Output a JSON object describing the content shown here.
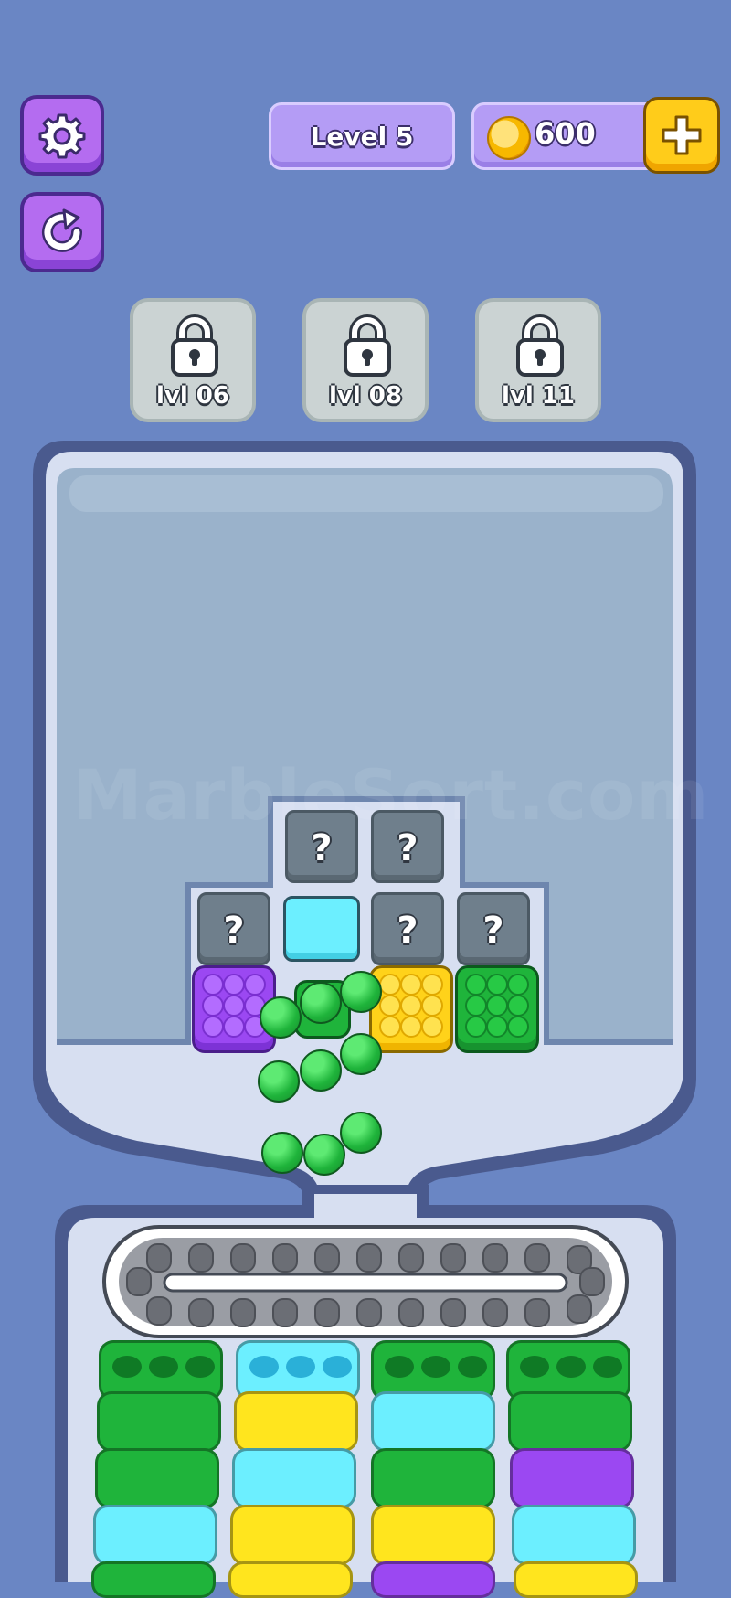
{
  "hud": {
    "settings_icon": "gear-icon",
    "restart_icon": "restart-icon",
    "level_label": "Level 5",
    "coins": "600",
    "coin_icon": "coin-icon",
    "add_icon": "plus-icon"
  },
  "locked_slots": [
    {
      "label": "lvl 06",
      "icon": "lock-icon"
    },
    {
      "label": "lvl 08",
      "icon": "lock-icon"
    },
    {
      "label": "lvl 11",
      "icon": "lock-icon"
    }
  ],
  "watermark": "MarbleSort.com",
  "grid": {
    "hidden_tile_label": "?",
    "tiles": [
      "?",
      "?",
      "?",
      "?",
      "?",
      "?"
    ],
    "boxes": [
      {
        "color": "purple",
        "hex": "#9b48f2"
      },
      {
        "color": "green",
        "hex": "#1fb43b"
      },
      {
        "color": "yellow",
        "hex": "#ffd21a"
      },
      {
        "color": "green",
        "hex": "#1fb43b"
      }
    ]
  },
  "colors": {
    "background": "#6a86c4",
    "container": "#95aecb",
    "green": "#1fb43b",
    "cyan": "#6cefff",
    "yellow": "#ffe51e",
    "purple": "#9b48f2"
  },
  "tubes": [
    {
      "cap": "green",
      "stack": [
        "green",
        "green",
        "cyan",
        "green"
      ]
    },
    {
      "cap": "cyan",
      "stack": [
        "yellow",
        "cyan",
        "yellow",
        "yellow"
      ]
    },
    {
      "cap": "green",
      "stack": [
        "cyan",
        "green",
        "yellow",
        "purple"
      ]
    },
    {
      "cap": "green",
      "stack": [
        "green",
        "purple",
        "cyan",
        "yellow"
      ]
    }
  ]
}
